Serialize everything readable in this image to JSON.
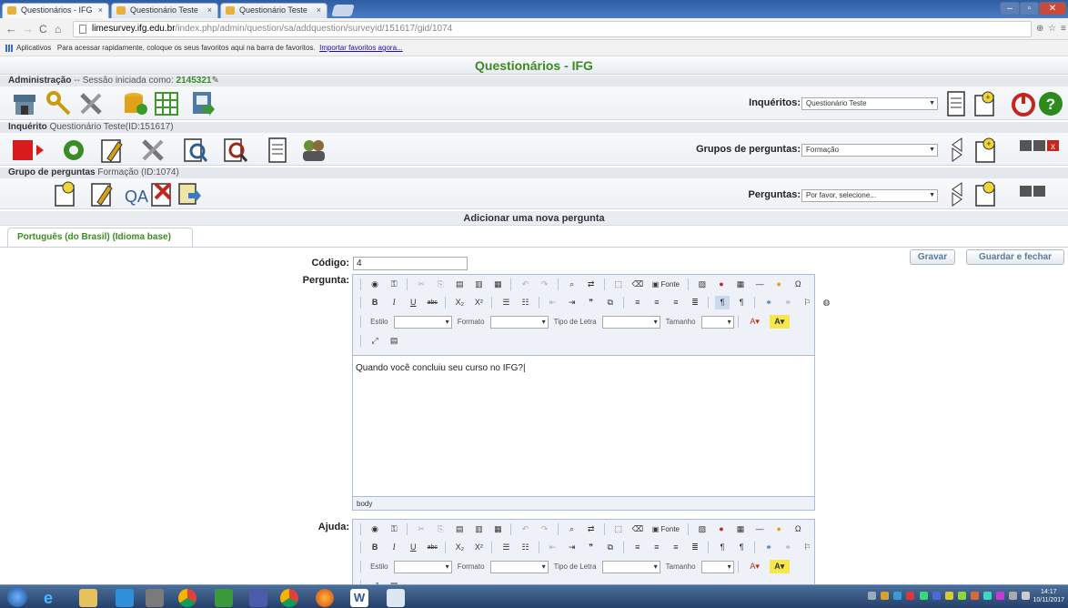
{
  "browser": {
    "tabs": [
      {
        "label": "Questionários - IFG"
      },
      {
        "label": "Questionário Teste"
      },
      {
        "label": "Questionário Teste"
      }
    ],
    "url_host": "limesurvey.ifg.edu.br",
    "url_path": "/index.php/admin/question/sa/addquestion/surveyid/151617/gid/1074",
    "bookmarks_apps": "Aplicativos",
    "bookmarks_hint": "Para acessar rapidamente, coloque os seus favoritos aqui na barra de favoritos.",
    "bookmarks_link": "Importar favoritos agora..."
  },
  "app_title": "Questionários - IFG",
  "admin": {
    "label": "Administração",
    "session_text": "-- Sessão iniciada como:",
    "user_id": "2145321",
    "surveys_label": "Inquéritos:",
    "surveys_selected": "Questionário Teste"
  },
  "survey": {
    "label": "Inquérito",
    "name": "Questionário Teste(ID:151617)",
    "groups_label": "Grupos de perguntas:",
    "groups_selected": "Formação"
  },
  "group": {
    "label": "Grupo de perguntas",
    "name": "Formação (ID:1074)",
    "questions_label": "Perguntas:",
    "questions_selected": "Por favor, selecione..."
  },
  "form": {
    "heading": "Adicionar uma nova pergunta",
    "lang_tab": "Português (do Brasil) (Idioma base)",
    "save_label": "Gravar",
    "save_close_label": "Guardar e fechar",
    "code_label": "Código:",
    "code_value": "4",
    "question_label": "Pergunta:",
    "question_text": "Quando você concluiu seu curso no IFG?|",
    "help_label": "Ajuda:",
    "editor_footer": "body",
    "toolbar": {
      "source": "Fonte",
      "style": "Estilo",
      "format": "Formato",
      "font": "Tipo de Letra",
      "size": "Tamanho",
      "bold": "B",
      "italic": "I",
      "underline": "U",
      "strike": "abc",
      "sub": "X₂",
      "sup": "X²",
      "omega": "Ω"
    }
  },
  "taskbar": {
    "clock_time": "14:17",
    "clock_date": "10/11/2017"
  }
}
